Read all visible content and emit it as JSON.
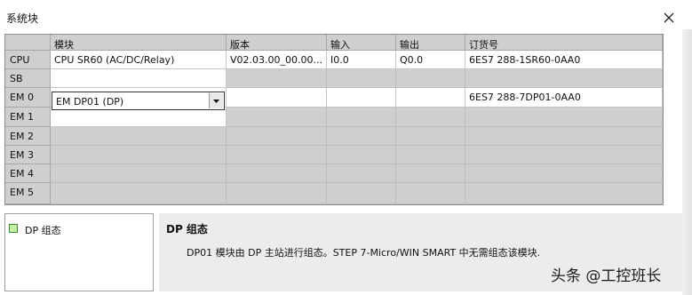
{
  "window": {
    "title": "系统块",
    "close_icon": "close-icon"
  },
  "table": {
    "columns": [
      "模块",
      "版本",
      "输入",
      "输出",
      "订货号"
    ],
    "rows": [
      {
        "slot": "CPU",
        "module": "CPU SR60 (AC/DC/Relay)",
        "version": "V02.03.00_00.00...",
        "input": "I0.0",
        "output": "Q0.0",
        "order": "6ES7 288-1SR60-0AA0"
      },
      {
        "slot": "SB",
        "module": "",
        "version": "",
        "input": "",
        "output": "",
        "order": ""
      },
      {
        "slot": "EM 0",
        "module": "EM DP01 (DP)",
        "version": "",
        "input": "",
        "output": "",
        "order": "6ES7 288-7DP01-0AA0"
      },
      {
        "slot": "EM 1",
        "module": "",
        "version": "",
        "input": "",
        "output": "",
        "order": ""
      },
      {
        "slot": "EM 2",
        "module": "",
        "version": "",
        "input": "",
        "output": "",
        "order": ""
      },
      {
        "slot": "EM 3",
        "module": "",
        "version": "",
        "input": "",
        "output": "",
        "order": ""
      },
      {
        "slot": "EM 4",
        "module": "",
        "version": "",
        "input": "",
        "output": "",
        "order": ""
      },
      {
        "slot": "EM 5",
        "module": "",
        "version": "",
        "input": "",
        "output": "",
        "order": ""
      }
    ]
  },
  "tree": {
    "items": [
      {
        "label": "DP 组态",
        "icon": "green-square-icon"
      }
    ]
  },
  "info": {
    "title": "DP 组态",
    "description": "DP01 模块由 DP 主站进行组态。STEP 7-Micro/WIN SMART 中无需组态该模块."
  },
  "watermark": "头条 @工控班长"
}
